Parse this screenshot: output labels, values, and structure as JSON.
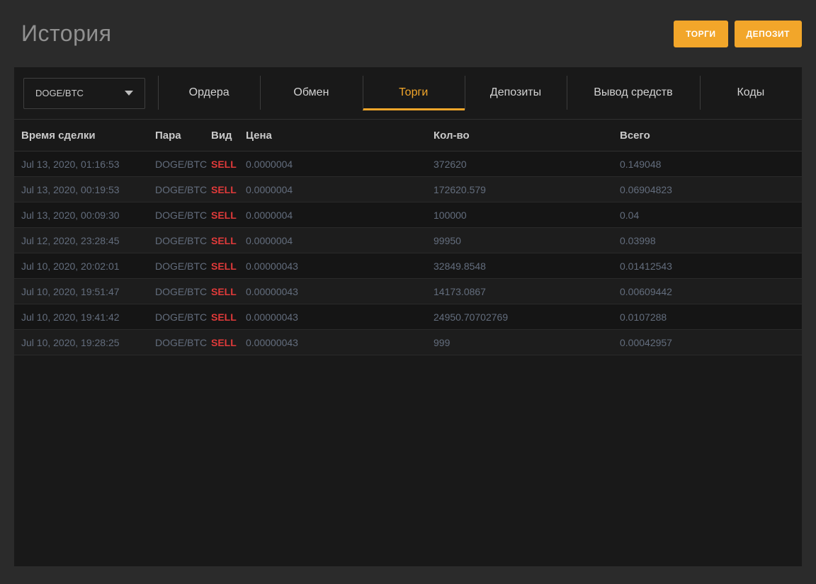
{
  "page": {
    "title": "История"
  },
  "header": {
    "buttons": [
      {
        "key": "trades",
        "label": "ТОРГИ"
      },
      {
        "key": "deposit",
        "label": "ДЕПОЗИТ"
      }
    ]
  },
  "filter": {
    "pair": "DOGE/BTC"
  },
  "tabs": [
    {
      "key": "orders",
      "label": "Ордера",
      "active": false,
      "wide": false
    },
    {
      "key": "exchange",
      "label": "Обмен",
      "active": false,
      "wide": false
    },
    {
      "key": "trades",
      "label": "Торги",
      "active": true,
      "wide": false
    },
    {
      "key": "deposits",
      "label": "Депозиты",
      "active": false,
      "wide": false
    },
    {
      "key": "withdrawals",
      "label": "Вывод средств",
      "active": false,
      "wide": true
    },
    {
      "key": "codes",
      "label": "Коды",
      "active": false,
      "wide": false
    }
  ],
  "table": {
    "columns": [
      "Время сделки",
      "Пара",
      "Вид",
      "Цена",
      "Кол-во",
      "Всего"
    ],
    "rows": [
      {
        "time": "Jul 13, 2020, 01:16:53",
        "pair": "DOGE/BTC",
        "side": "SELL",
        "price": "0.0000004",
        "amount": "372620",
        "total": "0.149048"
      },
      {
        "time": "Jul 13, 2020, 00:19:53",
        "pair": "DOGE/BTC",
        "side": "SELL",
        "price": "0.0000004",
        "amount": "172620.579",
        "total": "0.06904823"
      },
      {
        "time": "Jul 13, 2020, 00:09:30",
        "pair": "DOGE/BTC",
        "side": "SELL",
        "price": "0.0000004",
        "amount": "100000",
        "total": "0.04"
      },
      {
        "time": "Jul 12, 2020, 23:28:45",
        "pair": "DOGE/BTC",
        "side": "SELL",
        "price": "0.0000004",
        "amount": "99950",
        "total": "0.03998"
      },
      {
        "time": "Jul 10, 2020, 20:02:01",
        "pair": "DOGE/BTC",
        "side": "SELL",
        "price": "0.00000043",
        "amount": "32849.8548",
        "total": "0.01412543"
      },
      {
        "time": "Jul 10, 2020, 19:51:47",
        "pair": "DOGE/BTC",
        "side": "SELL",
        "price": "0.00000043",
        "amount": "14173.0867",
        "total": "0.00609442"
      },
      {
        "time": "Jul 10, 2020, 19:41:42",
        "pair": "DOGE/BTC",
        "side": "SELL",
        "price": "0.00000043",
        "amount": "24950.70702769",
        "total": "0.0107288"
      },
      {
        "time": "Jul 10, 2020, 19:28:25",
        "pair": "DOGE/BTC",
        "side": "SELL",
        "price": "0.00000043",
        "amount": "999",
        "total": "0.00042957"
      }
    ]
  },
  "colors": {
    "accent": "#f2a62a",
    "sell": "#e03a3a",
    "page-bg": "#2b2b2b",
    "panel-bg": "#191919",
    "muted": "#636d7d"
  }
}
